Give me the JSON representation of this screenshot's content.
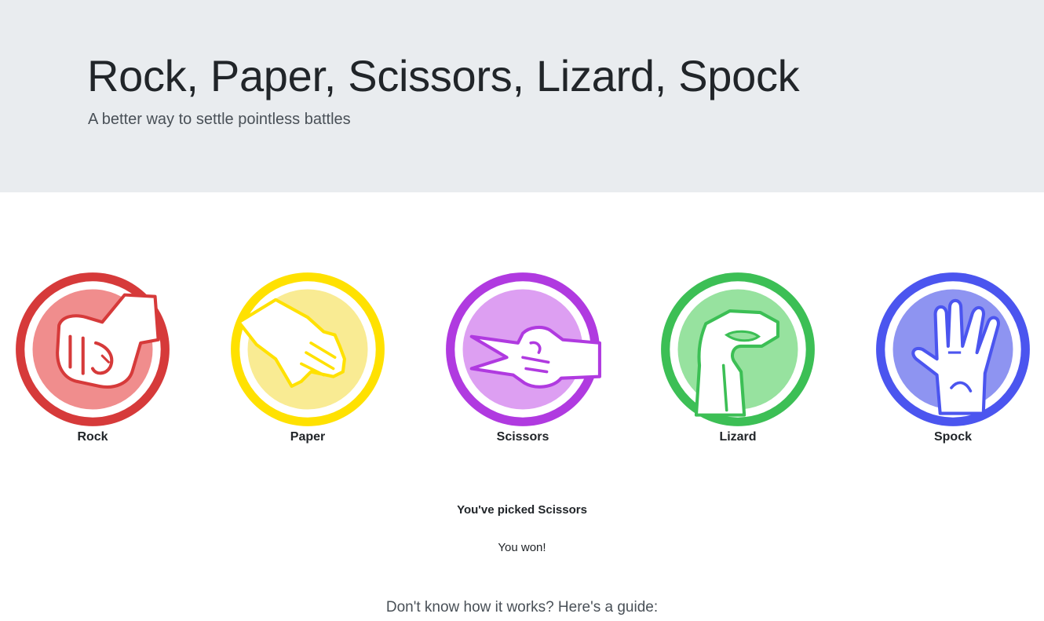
{
  "header": {
    "title": "Rock, Paper, Scissors, Lizard, Spock",
    "subtitle": "A better way to settle pointless battles"
  },
  "choices": [
    {
      "label": "Rock",
      "icon": "rock-fist-icon",
      "ring_color": "#d63a3a",
      "fill_color": "#f08d8d"
    },
    {
      "label": "Paper",
      "icon": "paper-hand-icon",
      "ring_color": "#ffe100",
      "fill_color": "#f9eb93"
    },
    {
      "label": "Scissors",
      "icon": "scissors-hand-icon",
      "ring_color": "#b03ae0",
      "fill_color": "#dd9ff2"
    },
    {
      "label": "Lizard",
      "icon": "lizard-hand-icon",
      "ring_color": "#3cbf55",
      "fill_color": "#97e29f"
    },
    {
      "label": "Spock",
      "icon": "spock-hand-icon",
      "ring_color": "#4b55ef",
      "fill_color": "#8e94f1"
    }
  ],
  "status": {
    "picked": "You've picked Scissors",
    "result": "You won!"
  },
  "guide": {
    "heading": "Don't know how it works? Here's a guide:"
  }
}
